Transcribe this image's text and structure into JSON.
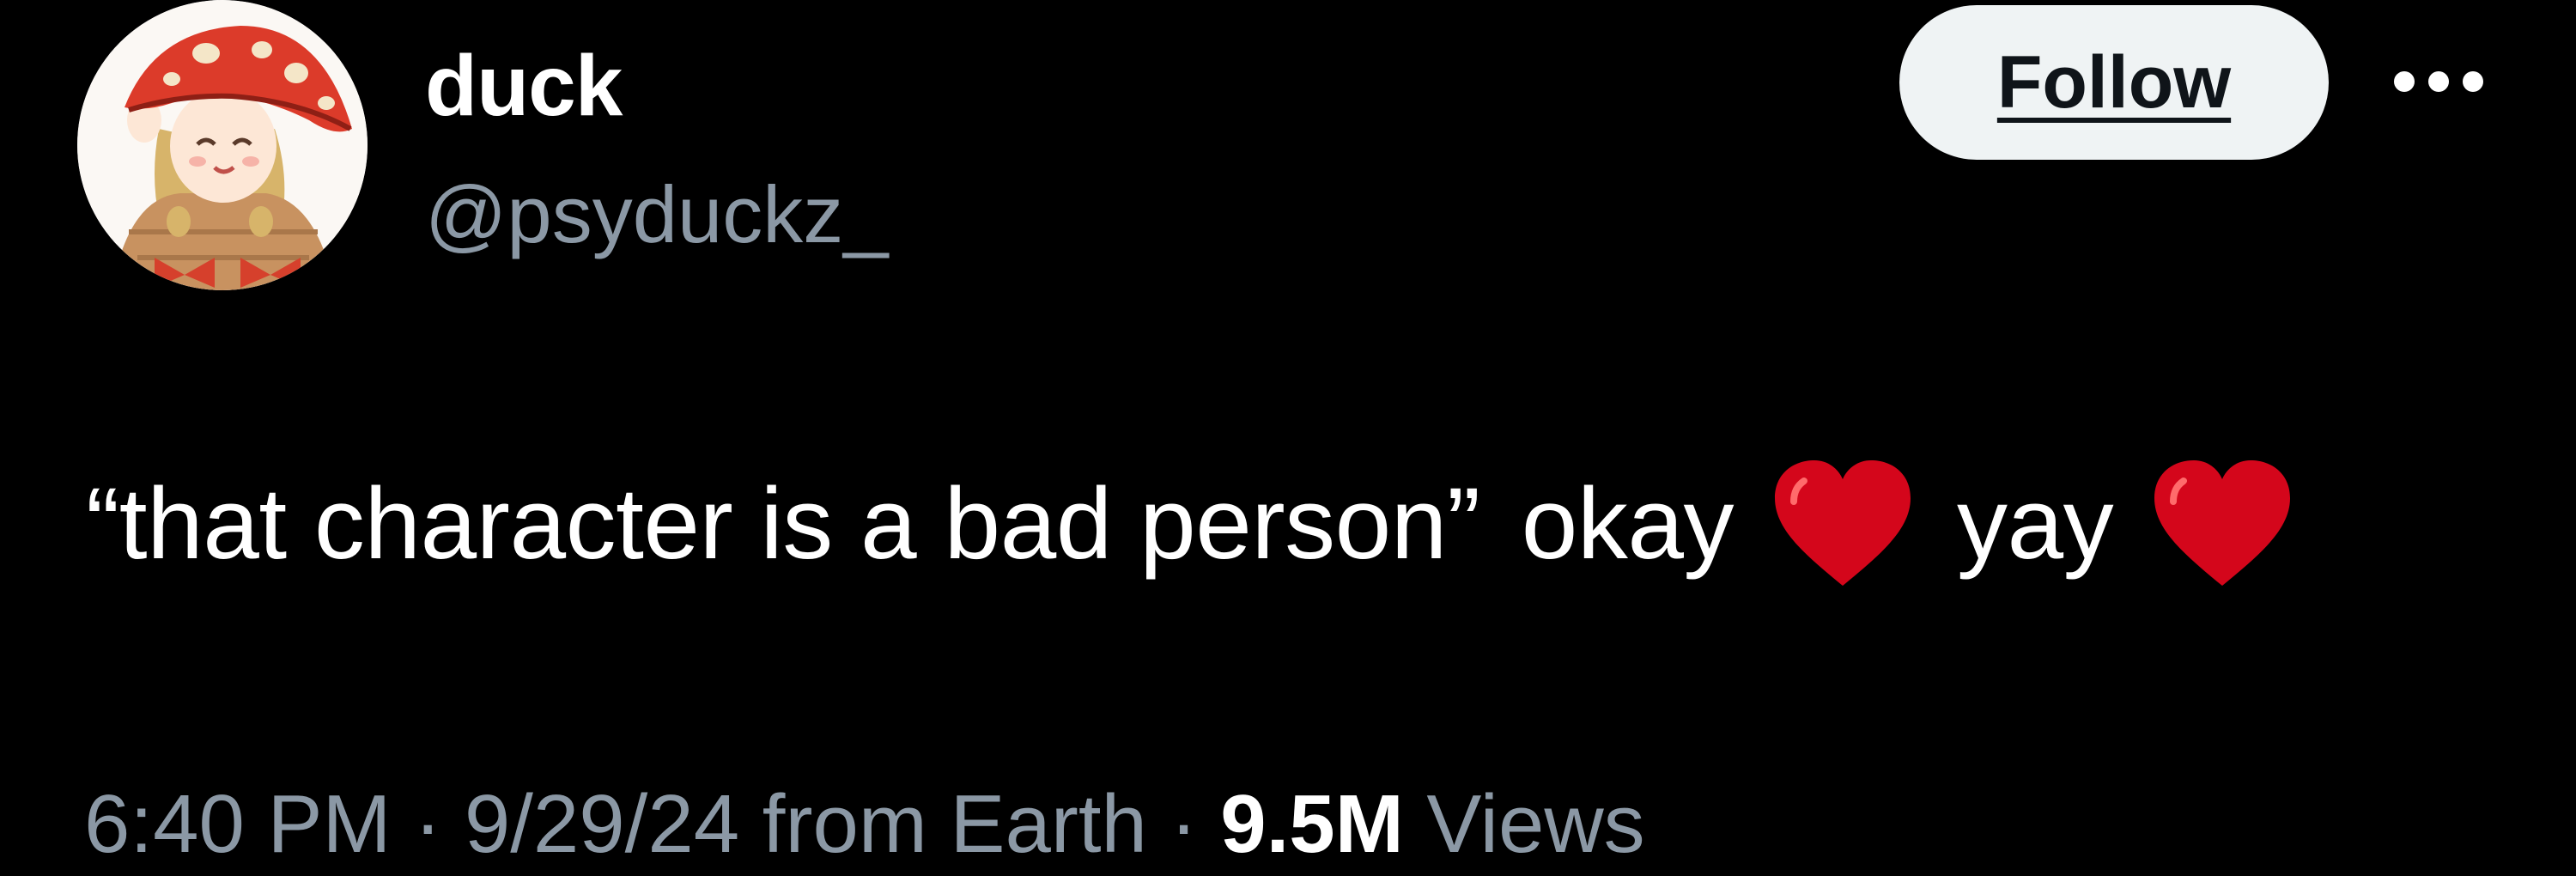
{
  "author": {
    "display_name": "duck",
    "handle": "@psyduckz_"
  },
  "follow_label": "Follow",
  "more_icon": "more-horizontal-icon",
  "tweet": {
    "text_quote": "“that character is a bad person”",
    "text_okay": "okay",
    "text_yay": "yay",
    "emoji": "heart-emoji"
  },
  "meta": {
    "time": "6:40 PM",
    "separator": "·",
    "date": "9/29/24",
    "source": "from Earth",
    "views_count": "9.5M",
    "views_label": "Views"
  },
  "colors": {
    "background": "#000000",
    "text_primary": "#ffffff",
    "text_secondary": "#8b98a5",
    "follow_bg": "#eff3f4",
    "heart_red": "#d4061b"
  }
}
